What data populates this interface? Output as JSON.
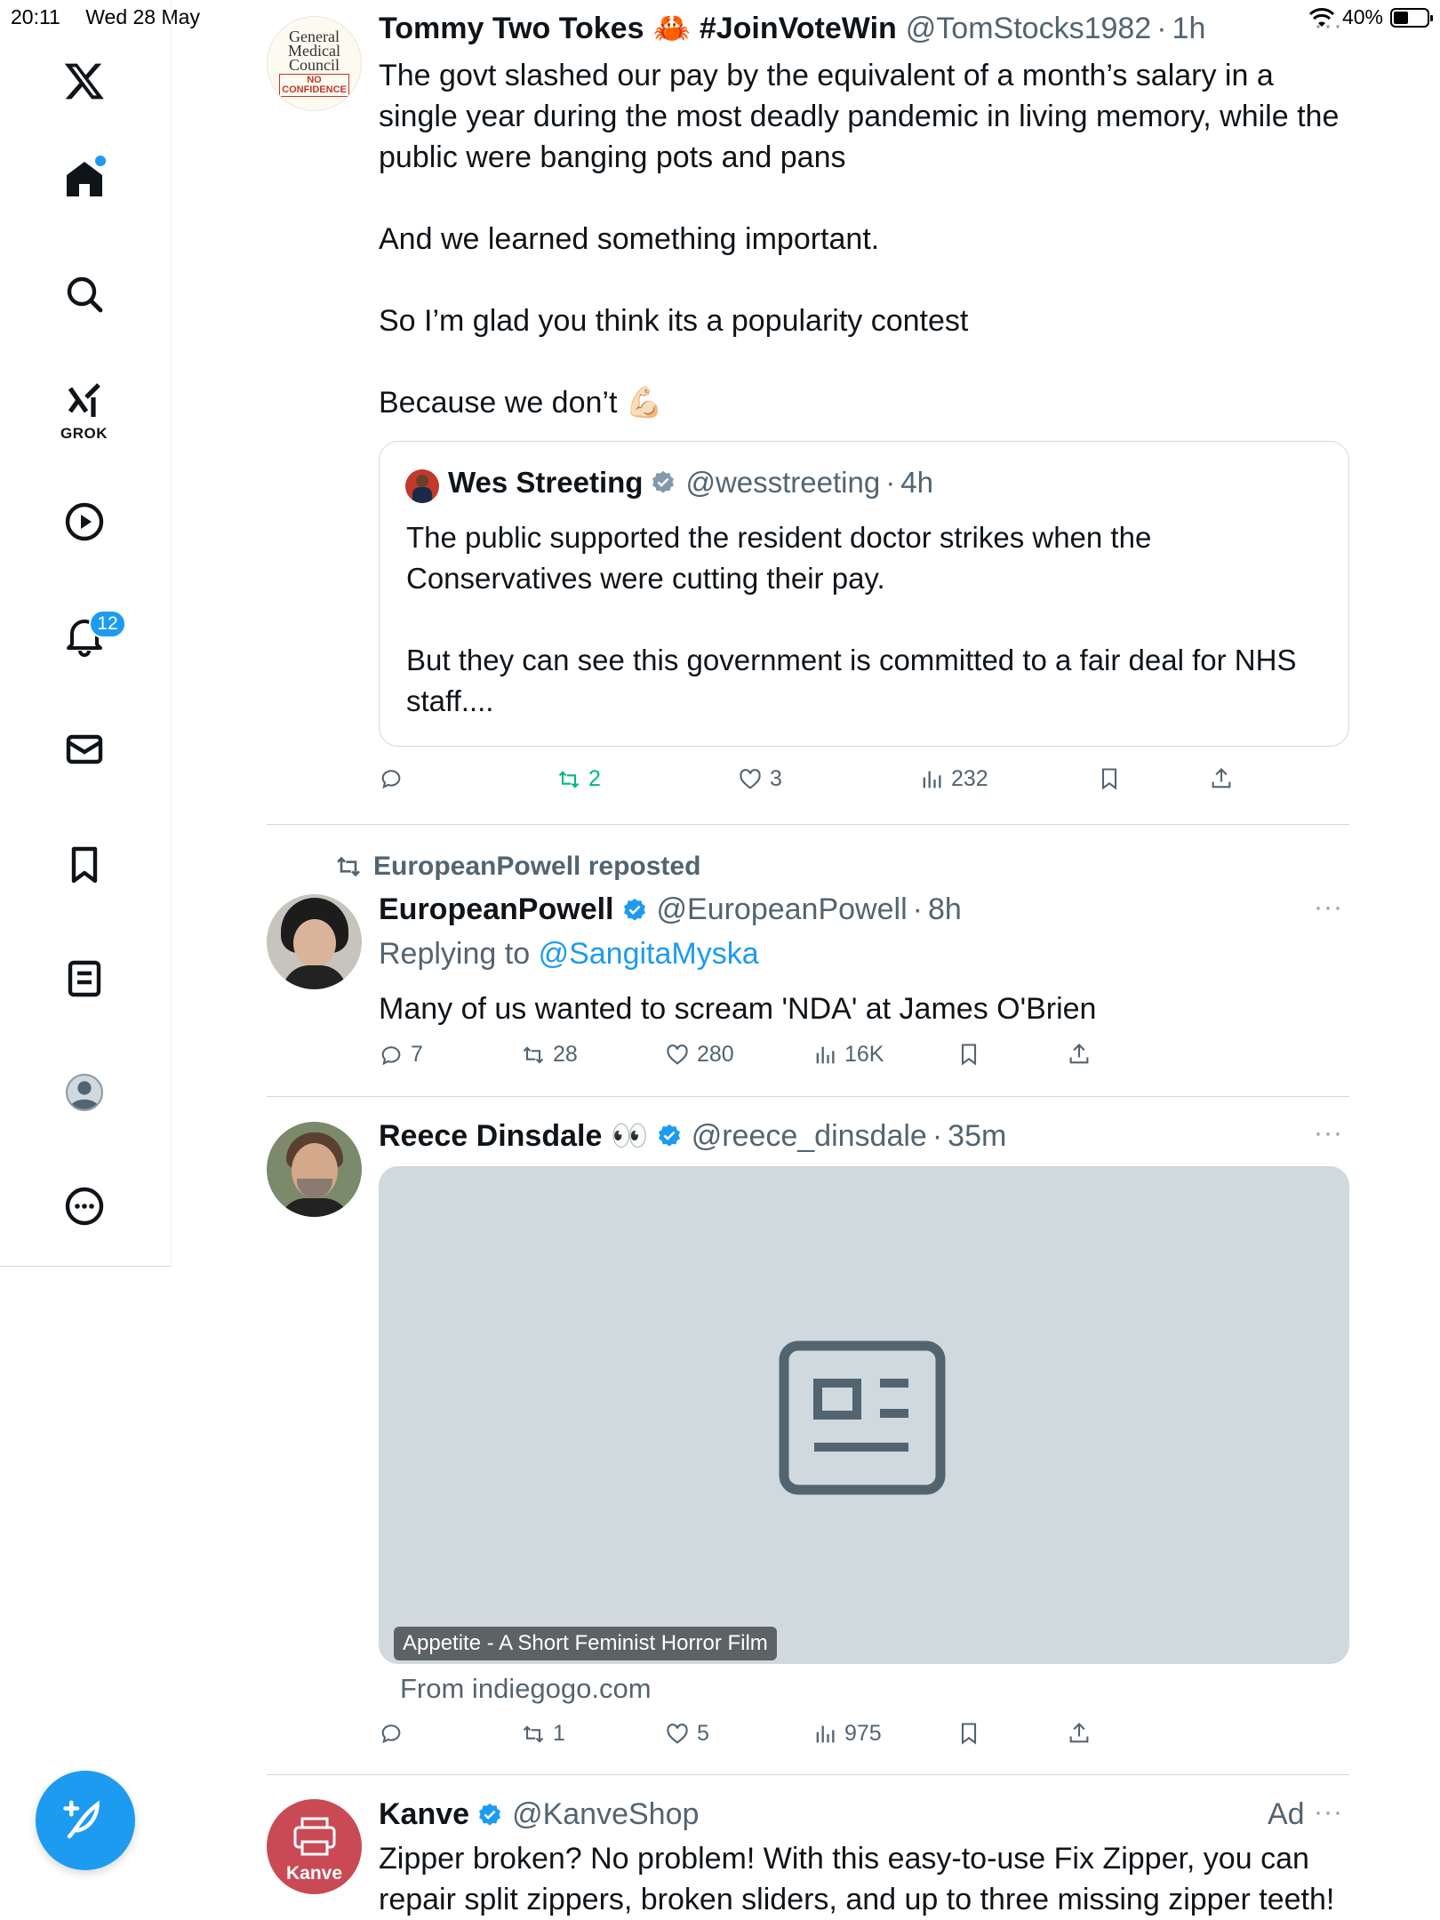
{
  "status_bar": {
    "time": "20:11",
    "date": "Wed 28 May",
    "battery": "40%"
  },
  "sidebar": {
    "grok_label": "GROK",
    "notifications_count": "12"
  },
  "tweets": [
    {
      "name": "Tommy Two Tokes",
      "emoji": "🦀",
      "hashtag": "#JoinVoteWin",
      "handle": "@TomStocks1982",
      "time": "1h",
      "avatar_lines": [
        "General",
        "Medical",
        "Council",
        "NO",
        "CONFIDENCE"
      ],
      "paragraphs": [
        "The govt slashed our pay by the equivalent of a month’s salary in a single year during the most deadly pandemic in living memory, while the public were banging pots and pans",
        "And we learned something important.",
        "So I’m glad you think its a popularity contest",
        "Because we don’t 💪🏻"
      ],
      "quote": {
        "name": "Wes Streeting",
        "handle": "@wesstreeting",
        "time": "4h",
        "paragraphs": [
          "The public supported the resident doctor strikes when the Conservatives were cutting their pay.",
          "But they can see this government is committed to a fair deal for NHS staff...."
        ]
      },
      "stats": {
        "replies": "",
        "reposts": "2",
        "likes": "3",
        "views": "232"
      }
    },
    {
      "repost_label": "EuropeanPowell reposted",
      "name": "EuropeanPowell",
      "handle": "@EuropeanPowell",
      "time": "8h",
      "replying_prefix": "Replying to",
      "replying_to": "@SangitaMyska",
      "text": "Many of us wanted to scream 'NDA' at James O'Brien",
      "stats": {
        "replies": "7",
        "reposts": "28",
        "likes": "280",
        "views": "16K"
      }
    },
    {
      "name": "Reece Dinsdale",
      "emoji": "👀",
      "handle": "@reece_dinsdale",
      "time": "35m",
      "card_caption": "Appetite - A Short Feminist Horror Film",
      "card_source": "From indiegogo.com",
      "stats": {
        "replies": "",
        "reposts": "1",
        "likes": "5",
        "views": "975"
      }
    },
    {
      "name": "Kanve",
      "handle": "@KanveShop",
      "ad_label": "Ad",
      "avatar_text": "Kanve",
      "text": "Zipper broken? No problem! With this easy-to-use Fix Zipper, you can repair split zippers, broken sliders, and up to three missing zipper teeth!"
    }
  ],
  "colors": {
    "accent": "#1d9bf0",
    "repost_green": "#00ba7c",
    "muted": "#536471"
  }
}
